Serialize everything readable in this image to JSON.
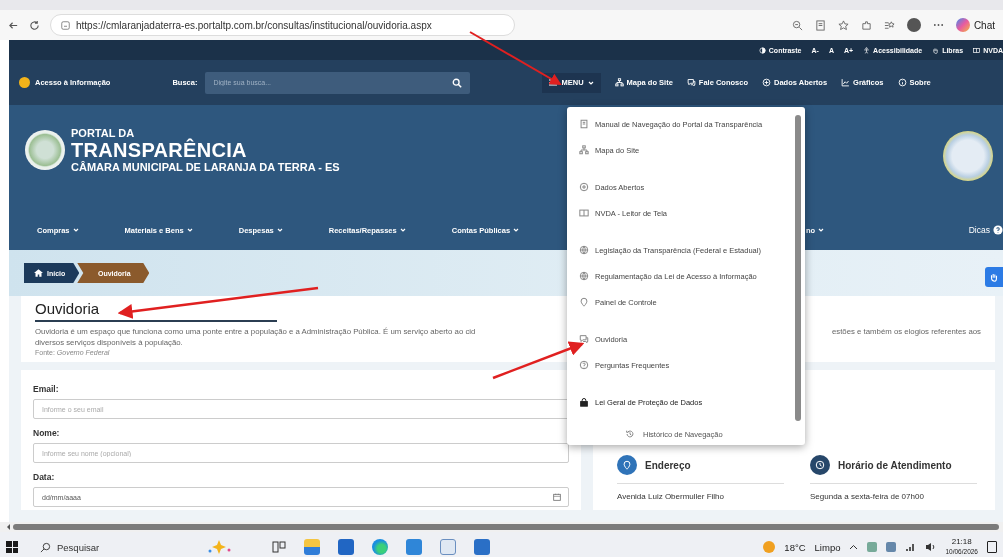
{
  "browser": {
    "url": "https://cmlaranjadaterra-es.portaltp.com.br/consultas/institucional/ouvidoria.aspx",
    "chat_label": "Chat"
  },
  "accessibility_bar": {
    "items": [
      "Contraste",
      "A-",
      "A",
      "A+",
      "Acessibilidade",
      "Libras",
      "NVDA"
    ]
  },
  "top_nav": {
    "access_label": "Acesso à Informação",
    "search_label": "Busca:",
    "search_placeholder": "Digite sua busca...",
    "menu_label": "MENU",
    "links": [
      "Mapa do Site",
      "Fale Conosco",
      "Dados Abertos",
      "Gráficos",
      "Sobre"
    ]
  },
  "header": {
    "line_1": "PORTAL DA",
    "line_2": "TRANSPARÊNCIA",
    "line_3": "CÂMARA MUNICIPAL DE LARANJA DA TERRA - ES"
  },
  "main_nav": {
    "items": [
      "Compras",
      "Materiais e Bens",
      "Despesas",
      "Receitas/Repasses",
      "Contas Públicas"
    ],
    "partial_item": "no",
    "tips_label": "Dicas"
  },
  "breadcrumb": [
    {
      "label": "Início",
      "selected": false
    },
    {
      "label": "Ouvidoria",
      "selected": true
    }
  ],
  "page": {
    "title": "Ouvidoria",
    "description_line_1_start": "Ouvidoria é um espaço que funciona como uma ponte entre a população e a Administração Pública. É um serviço aberto ao cid",
    "description_line_1_end": "estões e também os elogios referentes aos",
    "description_line_2": "diversos serviços disponíveis à população.",
    "source": "Fonte: *Governo Federal*"
  },
  "form": {
    "fields": [
      {
        "label": "Email:",
        "placeholder": "Informe o seu email",
        "kind": "text"
      },
      {
        "label": "Nome:",
        "placeholder": "Informe seu nome (opcional)",
        "kind": "text"
      },
      {
        "label": "Data:",
        "placeholder": "dd/mm/aaaa",
        "kind": "date"
      }
    ]
  },
  "contact": [
    {
      "title": "Endereço",
      "text": "Avenida Luiz Obermuller Filho"
    },
    {
      "title": "Horário de Atendimento",
      "text": "Segunda a sexta-feira de 07h00"
    }
  ],
  "menu_dropdown": {
    "groups": [
      [
        "Manual de Navegação do Portal da Transparência",
        "Mapa do Site"
      ],
      [
        "Dados Abertos",
        "NVDA - Leitor de Tela"
      ],
      [
        "Legislação da Transparência (Federal e Estadual)",
        "Regulamentação da Lei de Acesso à Informação",
        "Painel de Controle"
      ],
      [
        "Ouvidoria",
        "Perguntas Frequentes"
      ],
      [
        "Lei Geral de Proteção de Dados"
      ]
    ],
    "footer": "Histórico de Navegação"
  },
  "taskbar": {
    "search_placeholder": "Pesquisar",
    "temperature": "18°C",
    "condition": "Limpo",
    "time": "21:18",
    "date": "10/06/2026"
  }
}
